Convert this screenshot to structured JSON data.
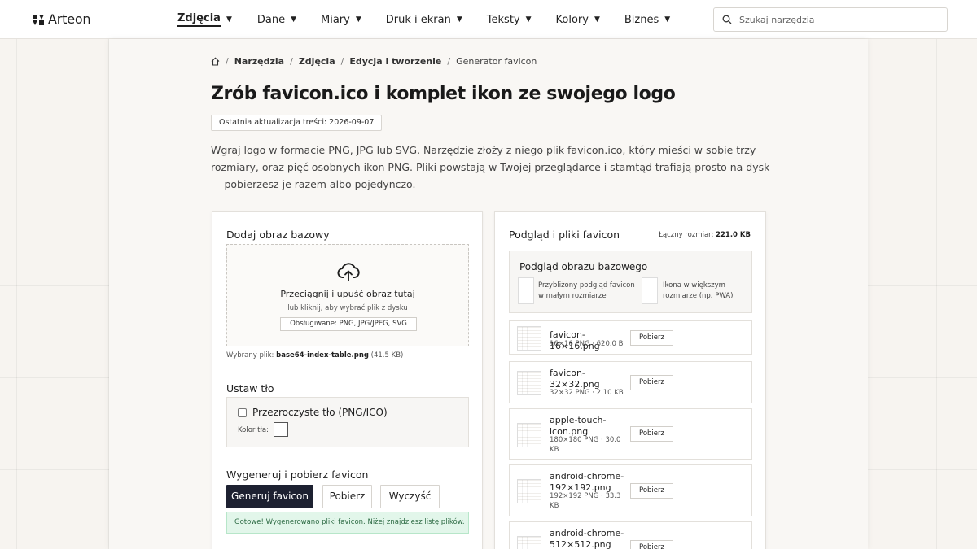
{
  "brand": {
    "name": "Arteon"
  },
  "nav": [
    {
      "label": "Zdjęcia",
      "active": true
    },
    {
      "label": "Dane"
    },
    {
      "label": "Miary"
    },
    {
      "label": "Druk i ekran"
    },
    {
      "label": "Teksty"
    },
    {
      "label": "Kolory"
    },
    {
      "label": "Biznes"
    }
  ],
  "search": {
    "placeholder": "Szukaj narzędzia"
  },
  "breadcrumb": [
    "Narzędzia",
    "Zdjęcia",
    "Edycja i tworzenie",
    "Generator favicon"
  ],
  "page": {
    "title": "Zrób favicon.ico i komplet ikon ze swojego logo",
    "updated": "Ostatnia aktualizacja treści: 2026-09-07",
    "intro": "Wgraj logo w formacie PNG, JPG lub SVG. Narzędzie złoży z niego plik favicon.ico, który mieści w sobie trzy rozmiary, oraz pięć osobnych ikon PNG. Pliki powstają w Twojej przeglądarce i stamtąd trafiają prosto na dysk — pobierzesz je razem albo pojedynczo."
  },
  "upload": {
    "heading": "Dodaj obraz bazowy",
    "drop_main": "Przeciągnij i upuść obraz tutaj",
    "drop_sub": "lub kliknij, aby wybrać plik z dysku",
    "supported": "Obsługiwane: PNG, JPG/JPEG, SVG",
    "selected_label": "Wybrany plik:",
    "selected_file": "base64-index-table.png",
    "selected_size": "(41.5 KB)"
  },
  "background": {
    "heading": "Ustaw tło",
    "transparent_label": "Przezroczyste tło (PNG/ICO)",
    "transparent_checked": false,
    "color_label": "Kolor tła:",
    "color_value": "#ffffff"
  },
  "generate": {
    "heading": "Wygeneruj i pobierz favicon",
    "generate_label": "Generuj favicon",
    "download_label": "Pobierz",
    "clear_label": "Wyczyść",
    "success": "Gotowe! Wygenerowano pliki favicon. Niżej znajdziesz listę plików."
  },
  "preview": {
    "heading": "Podgląd i pliki favicon",
    "total_label": "Łączny rozmiar:",
    "total_value": "221.0 KB",
    "base_title": "Podgląd obrazu bazowego",
    "small_desc": "Przybliżony podgląd favicon w małym rozmiarze",
    "large_desc": "Ikona w większym rozmiarze (np. PWA)",
    "download_label": "Pobierz",
    "files": [
      {
        "name": "favicon-16×16.png",
        "meta": "16×16 PNG · 620.0 B"
      },
      {
        "name": "favicon-32×32.png",
        "meta": "32×32 PNG · 2.10 KB"
      },
      {
        "name": "apple-touch-icon.png",
        "meta": "180×180 PNG · 30.0 KB"
      },
      {
        "name": "android-chrome-192×192.png",
        "meta": "192×192 PNG · 33.3 KB"
      },
      {
        "name": "android-chrome-512×512.png",
        "meta": ""
      }
    ]
  },
  "colors": {
    "primary_button": "#1d2131",
    "success_bg": "#e2f6ea",
    "page_bg": "#f7f4f0"
  }
}
